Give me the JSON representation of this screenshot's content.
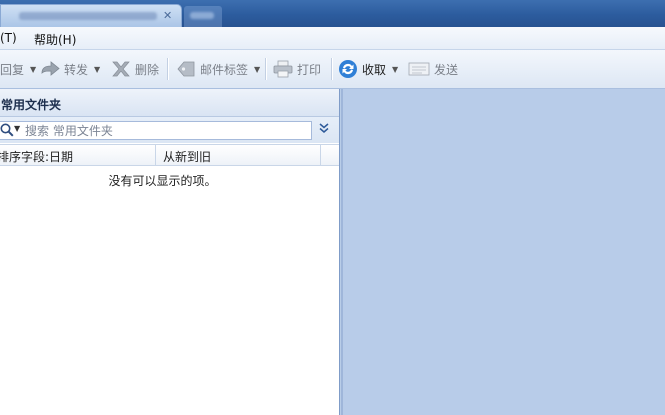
{
  "menubar": {
    "tools_label": "(T)",
    "help_label": "帮助(H)"
  },
  "toolbar": {
    "reply_label": "回复",
    "forward_label": "转发",
    "delete_label": "删除",
    "tag_label": "邮件标签",
    "print_label": "打印",
    "receive_label": "收取",
    "send_label": "发送"
  },
  "left_panel": {
    "title": "常用文件夹",
    "search_placeholder": "搜索 常用文件夹",
    "sort_field_label": "排序字段:日期",
    "sort_order_label": "从新到旧",
    "empty_message": "没有可以显示的项。"
  },
  "icons": {
    "forward": "forward-arrow-icon",
    "delete": "delete-x-icon",
    "tag": "tag-icon",
    "print": "printer-icon",
    "receive": "refresh-icon",
    "send": "send-icon",
    "search": "search-icon",
    "expand": "double-chevron-down-icon"
  },
  "colors": {
    "titlebar": "#2c5c9e",
    "right_pane": "#b8cce9",
    "accent_blue": "#2a72c8"
  }
}
